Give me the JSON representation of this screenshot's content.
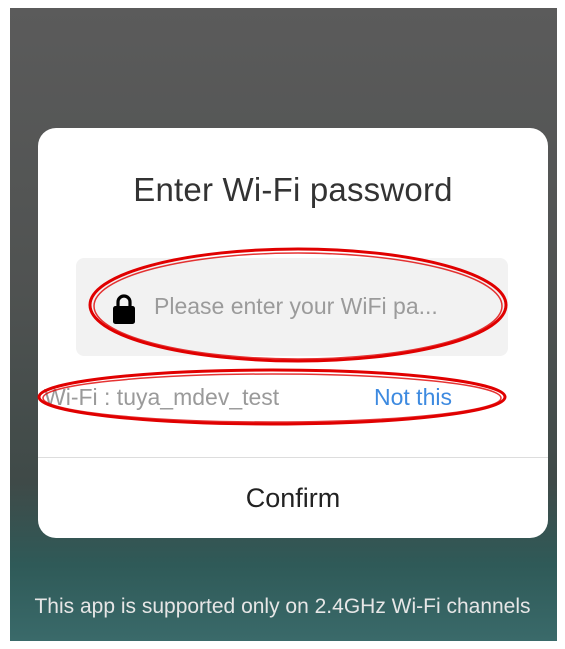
{
  "dialog": {
    "title": "Enter Wi-Fi password",
    "password_placeholder": "Please enter your WiFi pa...",
    "password_value": "",
    "wifi_label": "Wi-Fi : tuya_mdev_test",
    "not_this_label": "Not this",
    "confirm_label": "Confirm"
  },
  "footer": {
    "note": "This app is supported only on 2.4GHz Wi-Fi channels"
  },
  "icons": {
    "lock": "lock-icon"
  },
  "colors": {
    "accent_link": "#3d8ae0",
    "annotation_red": "#e00000",
    "dialog_bg": "#ffffff",
    "input_bg": "#f2f2f2"
  }
}
